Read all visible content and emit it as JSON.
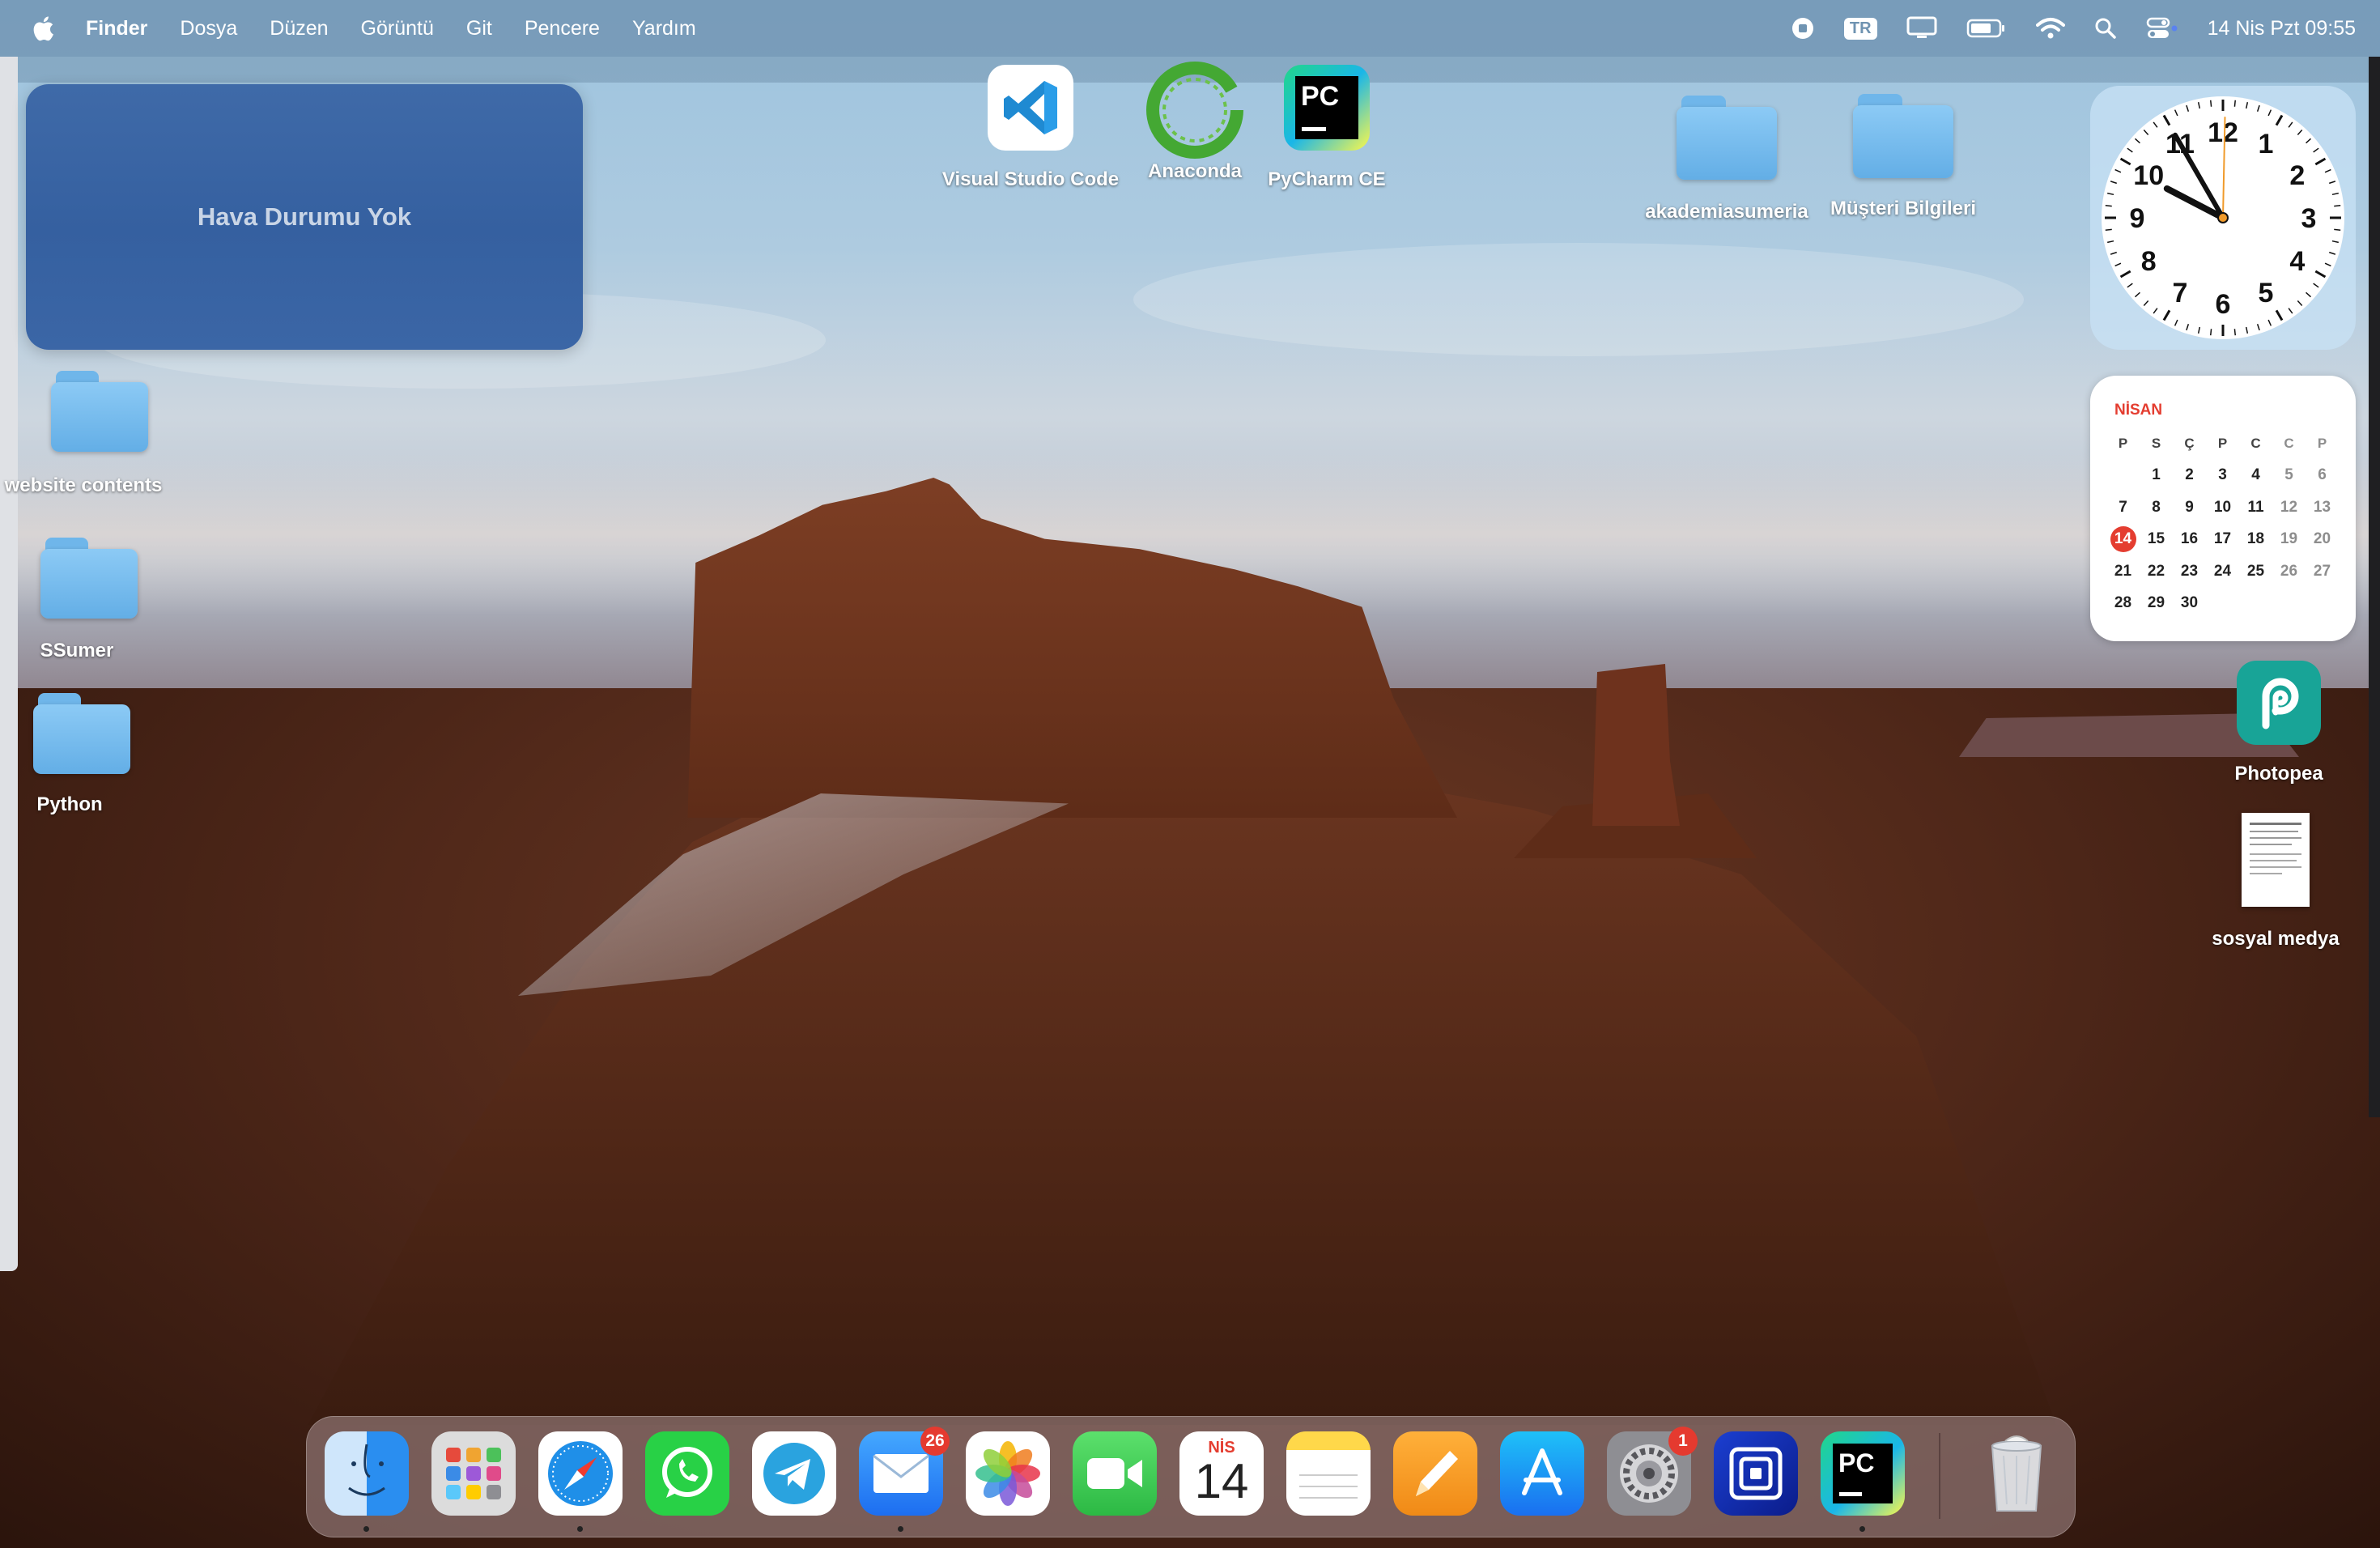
{
  "menubar": {
    "app_name": "Finder",
    "menus": [
      "Dosya",
      "Düzen",
      "Görüntü",
      "Git",
      "Pencere",
      "Yardım"
    ],
    "input_source": "TR",
    "datetime": "14 Nis Pzt  09:55"
  },
  "widgets": {
    "weather": {
      "text": "Hava Durumu Yok"
    },
    "clock": {
      "numbers": [
        "12",
        "1",
        "2",
        "3",
        "4",
        "5",
        "6",
        "7",
        "8",
        "9",
        "10",
        "11"
      ],
      "hour": 9,
      "minute": 55
    },
    "calendar": {
      "month": "NİSAN",
      "weekdays": [
        "P",
        "S",
        "Ç",
        "P",
        "C",
        "C",
        "P"
      ],
      "weeks": [
        [
          "",
          "1",
          "2",
          "3",
          "4",
          "5",
          "6"
        ],
        [
          "7",
          "8",
          "9",
          "10",
          "11",
          "12",
          "13"
        ],
        [
          "14",
          "15",
          "16",
          "17",
          "18",
          "19",
          "20"
        ],
        [
          "21",
          "22",
          "23",
          "24",
          "25",
          "26",
          "27"
        ],
        [
          "28",
          "29",
          "30",
          "",
          "",
          "",
          ""
        ]
      ],
      "today": "14"
    }
  },
  "desktop_icons": {
    "website_contents": "website contents",
    "ssumer": "SSumer",
    "python": "Python",
    "vscode": "Visual Studio Code",
    "anaconda": "Anaconda",
    "pycharm": "PyCharm CE",
    "akademiasumeria": "akademiasumeria",
    "musteri": "Müşteri Bilgileri",
    "photopea": "Photopea",
    "sosyal_medya": "sosyal medya"
  },
  "dock": {
    "mail_badge": "26",
    "settings_badge": "1",
    "calendar_month": "NİS",
    "calendar_day": "14",
    "pycharm_label": "PC"
  }
}
